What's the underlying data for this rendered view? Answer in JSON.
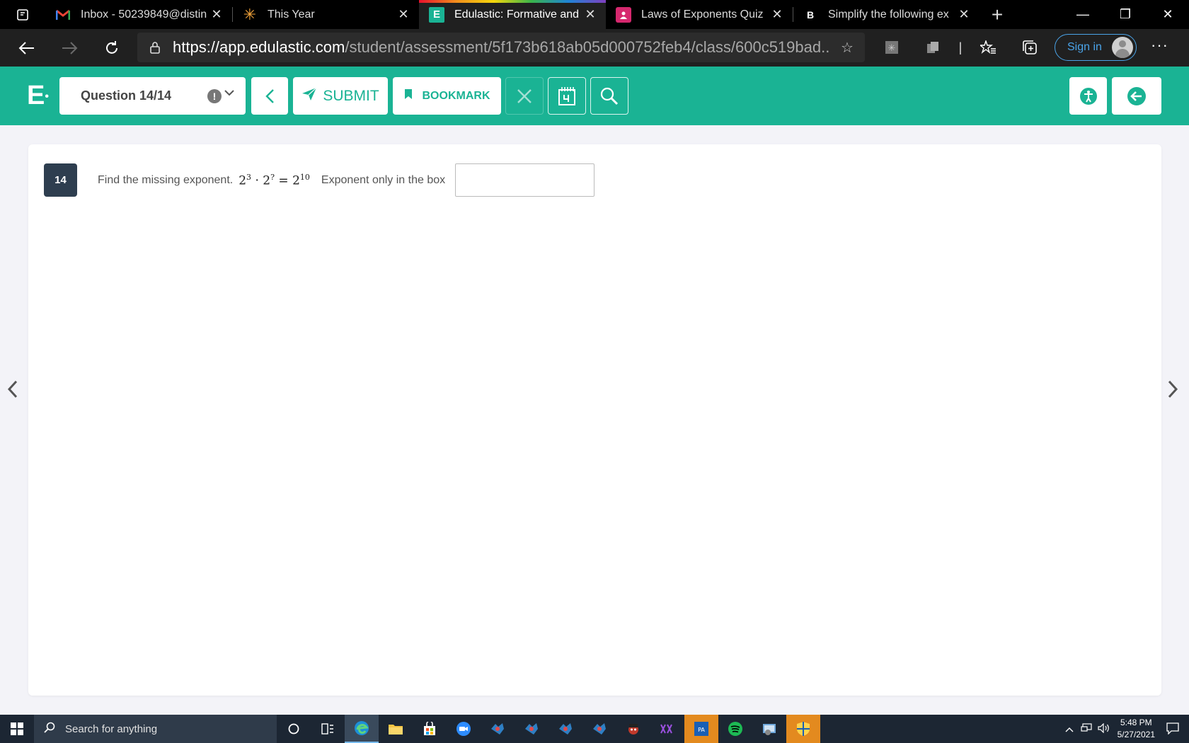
{
  "browser": {
    "tabs": [
      {
        "title": "Inbox - 50239849@distin",
        "icon": "gmail-icon",
        "active": false
      },
      {
        "title": "This Year",
        "icon": "sunburst-icon",
        "active": false
      },
      {
        "title": "Edulastic: Formative and",
        "icon": "edulastic-icon",
        "active": true
      },
      {
        "title": "Laws of Exponents Quiz",
        "icon": "classroom-icon",
        "active": false
      },
      {
        "title": "Simplify the following ex",
        "icon": "brainly-icon",
        "active": false
      }
    ],
    "url_domain": "https://app.edulastic.com",
    "url_path": "/student/assessment/5f173b618ab05d000752feb4/class/600c519bad...",
    "sign_in_label": "Sign in"
  },
  "header": {
    "logo": "E",
    "question_selector": "Question 14/14",
    "submit_label": "SUBMIT",
    "bookmark_label": "BOOKMARK"
  },
  "question": {
    "number": "14",
    "prompt": "Find the missing exponent.",
    "math_base1": "2",
    "math_exp1": "3",
    "math_op": "·",
    "math_base2": "2",
    "math_exp2": "?",
    "math_eq": "=",
    "math_base3": "2",
    "math_exp3": "10",
    "instruction": "Exponent only in the box",
    "answer_value": ""
  },
  "taskbar": {
    "search_placeholder": "Search for anything",
    "time": "5:48 PM",
    "date": "5/27/2021"
  },
  "colors": {
    "edulastic_green": "#1ab394",
    "question_badge": "#2e3e4f",
    "browser_dark": "#202020"
  }
}
